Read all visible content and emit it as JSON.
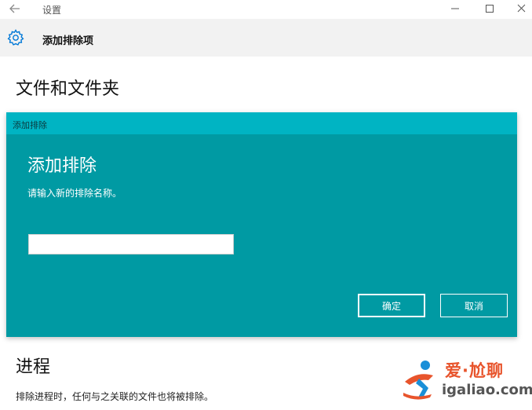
{
  "window": {
    "title": "设置"
  },
  "header": {
    "title": "添加排除项"
  },
  "page": {
    "section_title": "文件和文件夹",
    "process_title": "进程",
    "process_desc": "排除进程时，任何与之关联的文件也将被排除。"
  },
  "dialog": {
    "bar_title": "添加排除",
    "heading": "添加排除",
    "prompt": "请输入新的排除名称。",
    "input_value": "",
    "ok_label": "确定",
    "cancel_label": "取消"
  },
  "watermark": {
    "brand_cn": "爱·尬聊",
    "url": "igaliao.com"
  },
  "colors": {
    "dialog_bg": "#009aa3",
    "dialog_bar": "#00b4c3",
    "header_bg": "#f2f2f2",
    "accent_icon": "#0078d7",
    "watermark_orange": "#e8542c",
    "watermark_blue": "#1a8fd8"
  },
  "icons": {
    "back": "arrow-left-icon",
    "settings": "gear-icon",
    "minimize": "minimize-icon",
    "maximize": "maximize-icon",
    "close": "close-icon"
  }
}
